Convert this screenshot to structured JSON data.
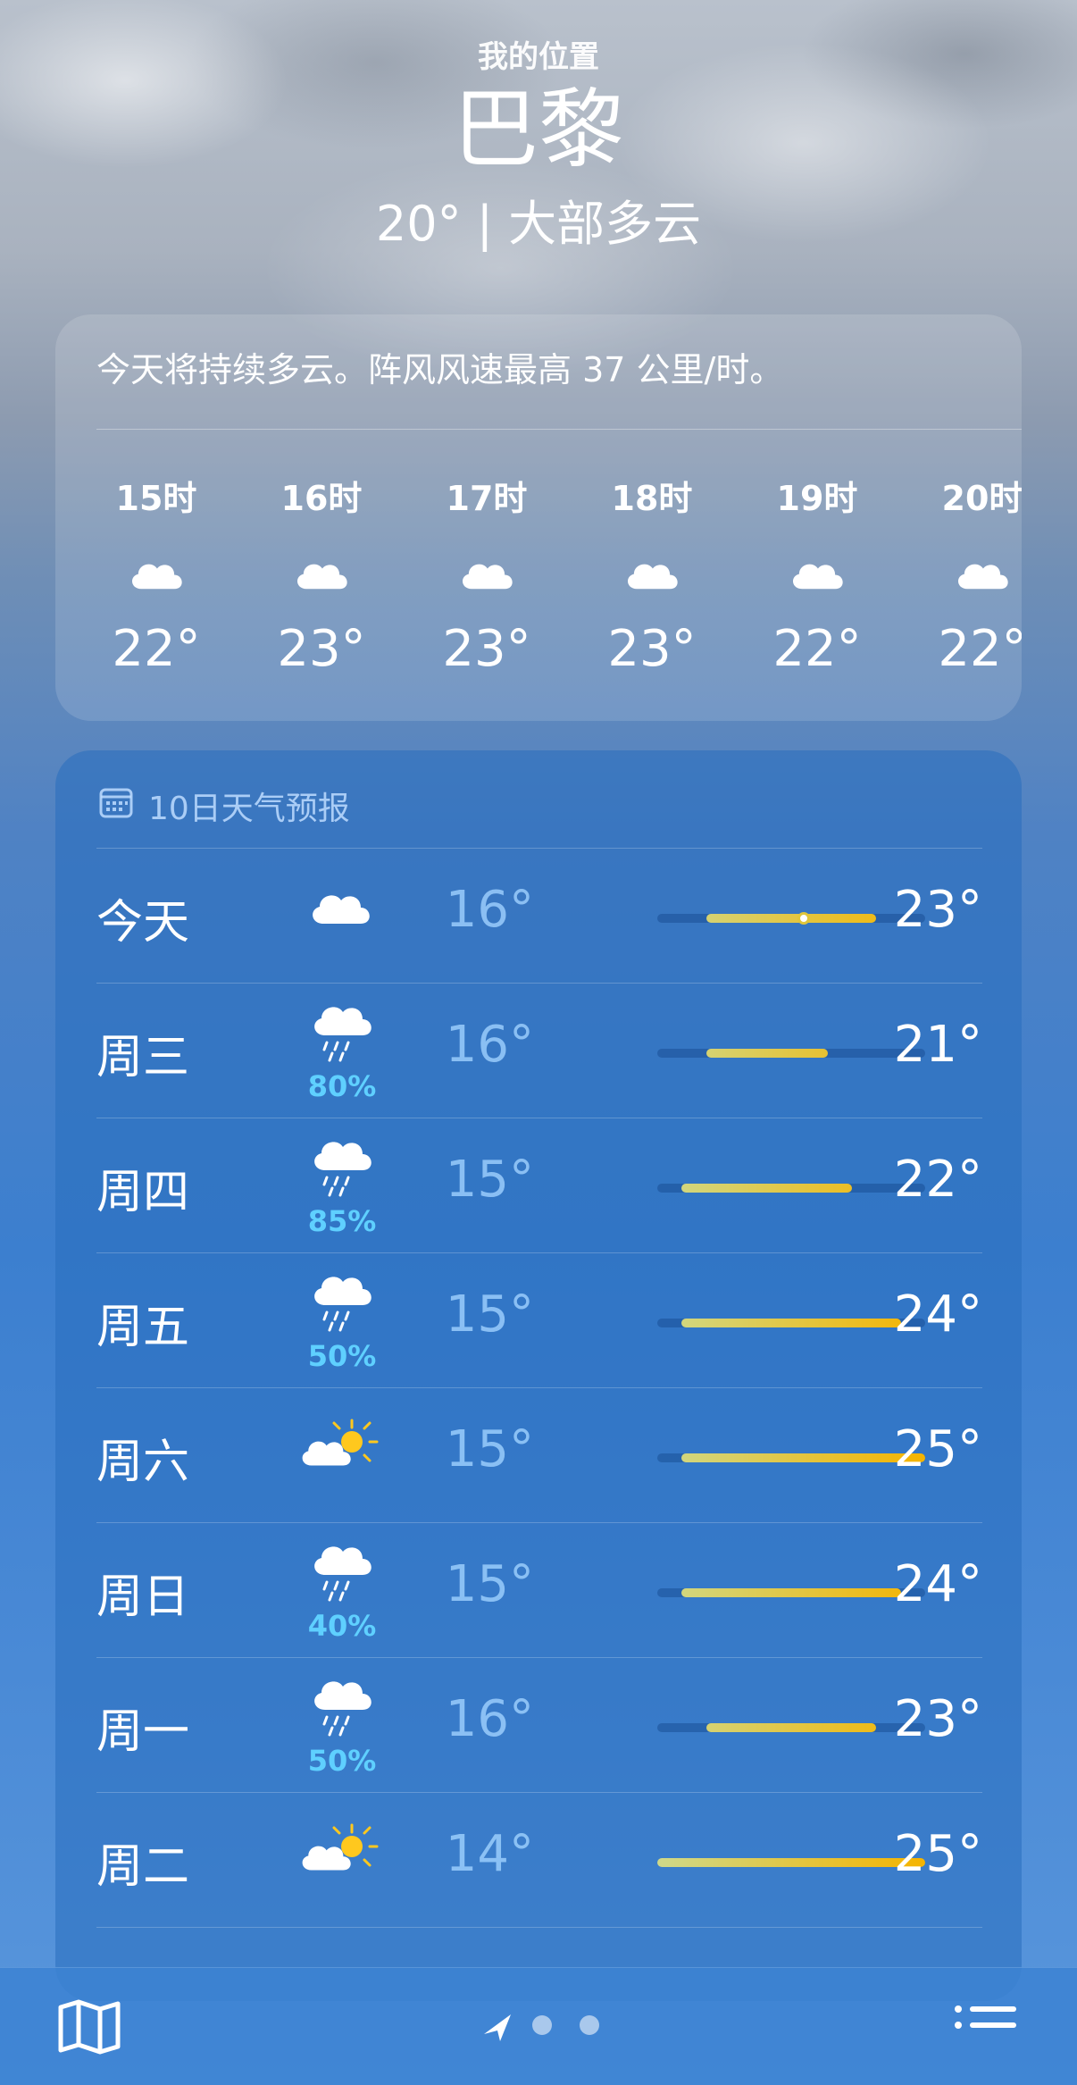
{
  "header": {
    "location_label": "我的位置",
    "city": "巴黎",
    "current": "20° | 大部多云"
  },
  "hourly": {
    "summary": "今天将持续多云。阵风风速最高 37 公里/时。",
    "items": [
      {
        "time": "15时",
        "icon": "cloud-icon",
        "temp": "22°"
      },
      {
        "time": "16时",
        "icon": "cloud-icon",
        "temp": "23°"
      },
      {
        "time": "17时",
        "icon": "cloud-icon",
        "temp": "23°"
      },
      {
        "time": "18时",
        "icon": "cloud-icon",
        "temp": "23°"
      },
      {
        "time": "19时",
        "icon": "cloud-icon",
        "temp": "22°"
      },
      {
        "time": "20时",
        "icon": "cloud-icon",
        "temp": "22°"
      }
    ]
  },
  "daily": {
    "title": "10日天气预报",
    "range_min": 14,
    "range_max": 25,
    "current_temp": 20,
    "rows": [
      {
        "day": "今天",
        "icon": "cloud-icon",
        "precip": "",
        "low": 16,
        "high": 23,
        "low_text": "16°",
        "high_text": "23°"
      },
      {
        "day": "周三",
        "icon": "cloud-rain-icon",
        "precip": "80%",
        "low": 16,
        "high": 21,
        "low_text": "16°",
        "high_text": "21°"
      },
      {
        "day": "周四",
        "icon": "cloud-rain-icon",
        "precip": "85%",
        "low": 15,
        "high": 22,
        "low_text": "15°",
        "high_text": "22°"
      },
      {
        "day": "周五",
        "icon": "cloud-rain-icon",
        "precip": "50%",
        "low": 15,
        "high": 24,
        "low_text": "15°",
        "high_text": "24°"
      },
      {
        "day": "周六",
        "icon": "partly-sunny-icon",
        "precip": "",
        "low": 15,
        "high": 25,
        "low_text": "15°",
        "high_text": "25°"
      },
      {
        "day": "周日",
        "icon": "cloud-rain-icon",
        "precip": "40%",
        "low": 15,
        "high": 24,
        "low_text": "15°",
        "high_text": "24°"
      },
      {
        "day": "周一",
        "icon": "cloud-rain-icon",
        "precip": "50%",
        "low": 16,
        "high": 23,
        "low_text": "16°",
        "high_text": "23°"
      },
      {
        "day": "周二",
        "icon": "partly-sunny-icon",
        "precip": "",
        "low": 14,
        "high": 25,
        "low_text": "14°",
        "high_text": "25°"
      }
    ]
  },
  "tabbar": {
    "map_icon": "map-icon",
    "location_icon": "location-arrow-icon",
    "list_icon": "list-icon",
    "pages": 3,
    "active_page": 0
  },
  "colors": {
    "bar_cool": "#cfd98a",
    "bar_warm": "#f5b400",
    "precip": "#5fd0ff"
  }
}
